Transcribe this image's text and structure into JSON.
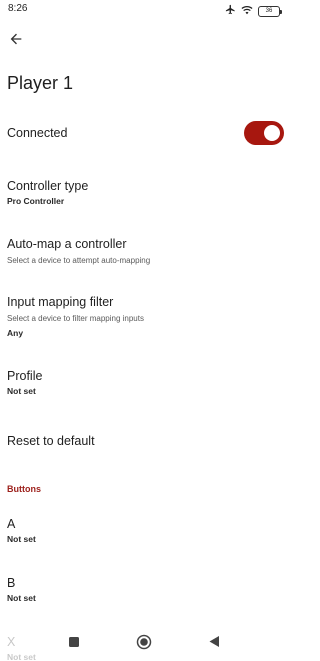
{
  "status_bar": {
    "time": "8:26",
    "battery": "36"
  },
  "header": {
    "title": "Player 1"
  },
  "settings": {
    "connected": {
      "label": "Connected",
      "enabled": true
    },
    "controller_type": {
      "label": "Controller type",
      "value": "Pro Controller"
    },
    "auto_map": {
      "label": "Auto-map a controller",
      "description": "Select a device to attempt auto-mapping"
    },
    "input_mapping_filter": {
      "label": "Input mapping filter",
      "description": "Select a device to filter mapping inputs",
      "value": "Any"
    },
    "profile": {
      "label": "Profile",
      "value": "Not set"
    },
    "reset": {
      "label": "Reset to default"
    }
  },
  "buttons_section": {
    "header": "Buttons",
    "items": [
      {
        "label": "A",
        "value": "Not set"
      },
      {
        "label": "B",
        "value": "Not set"
      },
      {
        "label": "X",
        "value": "Not set"
      }
    ]
  },
  "colors": {
    "accent": "#a7170f",
    "section_header": "#9c1f1a"
  },
  "nav_bar": {
    "icons": [
      "recents-icon",
      "home-icon",
      "back-icon"
    ]
  }
}
